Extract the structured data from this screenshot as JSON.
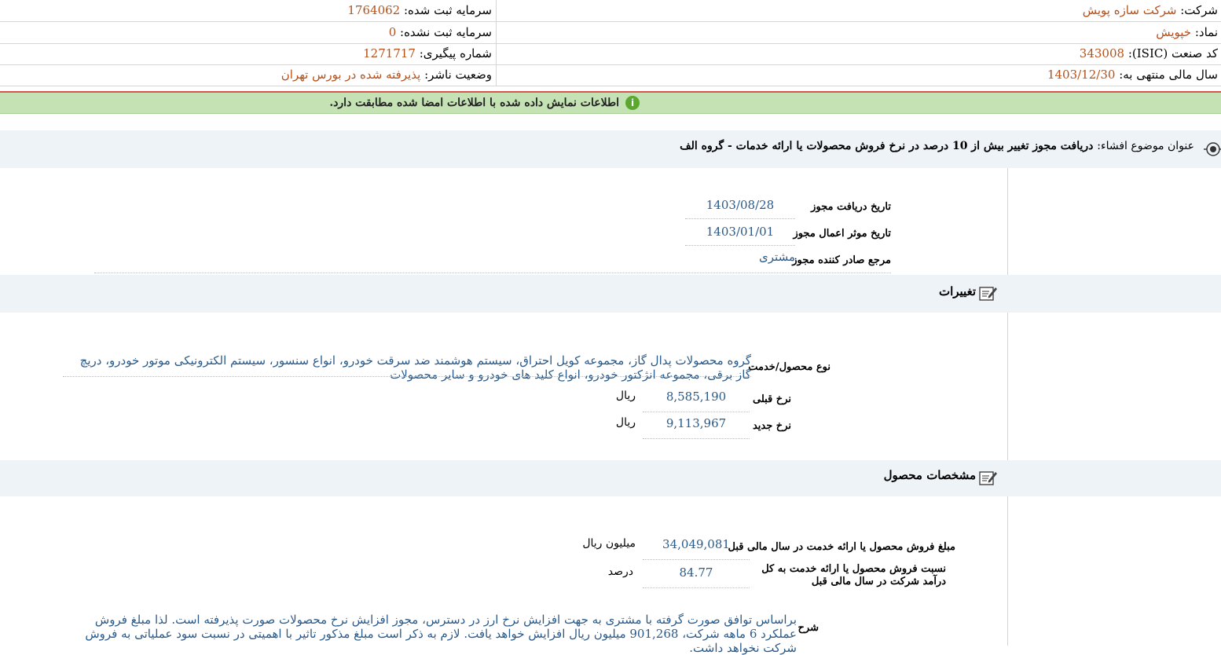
{
  "header": {
    "company_label": "شرکت:",
    "company_value": "شرکت سازه پویش",
    "symbol_label": "نماد:",
    "symbol_value": "خپویش",
    "isic_label": "کد صنعت (ISIC):",
    "isic_value": "343008",
    "fiscal_label": "سال مالی منتهی به:",
    "fiscal_value": "1403/12/30",
    "registered_capital_label": "سرمایه ثبت شده:",
    "registered_capital_value": "1764062",
    "unregistered_capital_label": "سرمایه ثبت نشده:",
    "unregistered_capital_value": "0",
    "tracking_label": "شماره پیگیری:",
    "tracking_value": "1271717",
    "publisher_status_label": "وضعیت ناشر:",
    "publisher_status_value": "پذیرفته شده در بورس تهران"
  },
  "info_bar": {
    "message": "اطلاعات نمایش داده شده با اطلاعات امضا شده مطابقت دارد.",
    "icon_glyph": "i"
  },
  "disclosure": {
    "title_label": "عنوان موضوع افشاء:",
    "title_value": "دریافت مجوز تغییر بیش از 10 درصد در نرخ فروش محصولات یا ارائه خدمات - گروه الف"
  },
  "permit": {
    "receive_date_label": "تاریخ دریافت مجوز",
    "receive_date_value": "1403/08/28",
    "effective_date_label": "تاریخ موثر اعمال مجوز",
    "effective_date_value": "1403/01/01",
    "issuer_label": "مرجع صادر کننده مجوز",
    "issuer_value": "مشتری"
  },
  "changes": {
    "section_title": "تغییرات",
    "product_type_label": "نوع محصول/خدمت",
    "product_type_value": "گروه محصولات پدال گاز، مجموعه کویل احتراق، سیستم هوشمند ضد سرقت خودرو، انواع سنسور، سیستم الکترونیکی موتور خودرو، دریچ گاز برقی، مجموعه انژکتور خودرو، انواع کلید های خودرو و سایر محصولات",
    "prev_rate_label": "نرخ قبلی",
    "prev_rate_value": "8,585,190",
    "prev_rate_unit": "ریال",
    "new_rate_label": "نرخ جدید",
    "new_rate_value": "9,113,967",
    "new_rate_unit": "ریال"
  },
  "product_specs": {
    "section_title": "مشخصات محصول",
    "sales_amount_label": "مبلغ فروش محصول یا ارائه خدمت در سال مالی قبل",
    "sales_amount_value": "34,049,081",
    "sales_amount_unit": "میلیون ریال",
    "sales_ratio_label": "نسبت فروش محصول یا ارائه خدمت به کل درآمد شرکت در سال مالی قبل",
    "sales_ratio_value": "84.77",
    "sales_ratio_unit": "درصد",
    "description_label": "شرح",
    "description_value": "براساس توافق صورت گرفته با مشتری به جهت افزایش نرخ ارز در دسترس، مجوز افزایش نرخ محصولات صورت پذیرفته است. لذا مبلغ فروش عملکرد 6 ماهه شرکت، 901,268 میلیون ریال افزایش خواهد یافت. لازم به ذکر است مبلغ مذکور تاثیر با اهمیتی در نسبت سود عملیاتی به فروش شرکت نخواهد داشت."
  },
  "colors": {
    "header_value": "#b5501a",
    "field_value": "#2a5a8a",
    "info_bar_bg": "#c4e2b4",
    "info_icon": "#5aa82d",
    "red_line": "#d9534f",
    "band_bg": "#eef3f8"
  }
}
